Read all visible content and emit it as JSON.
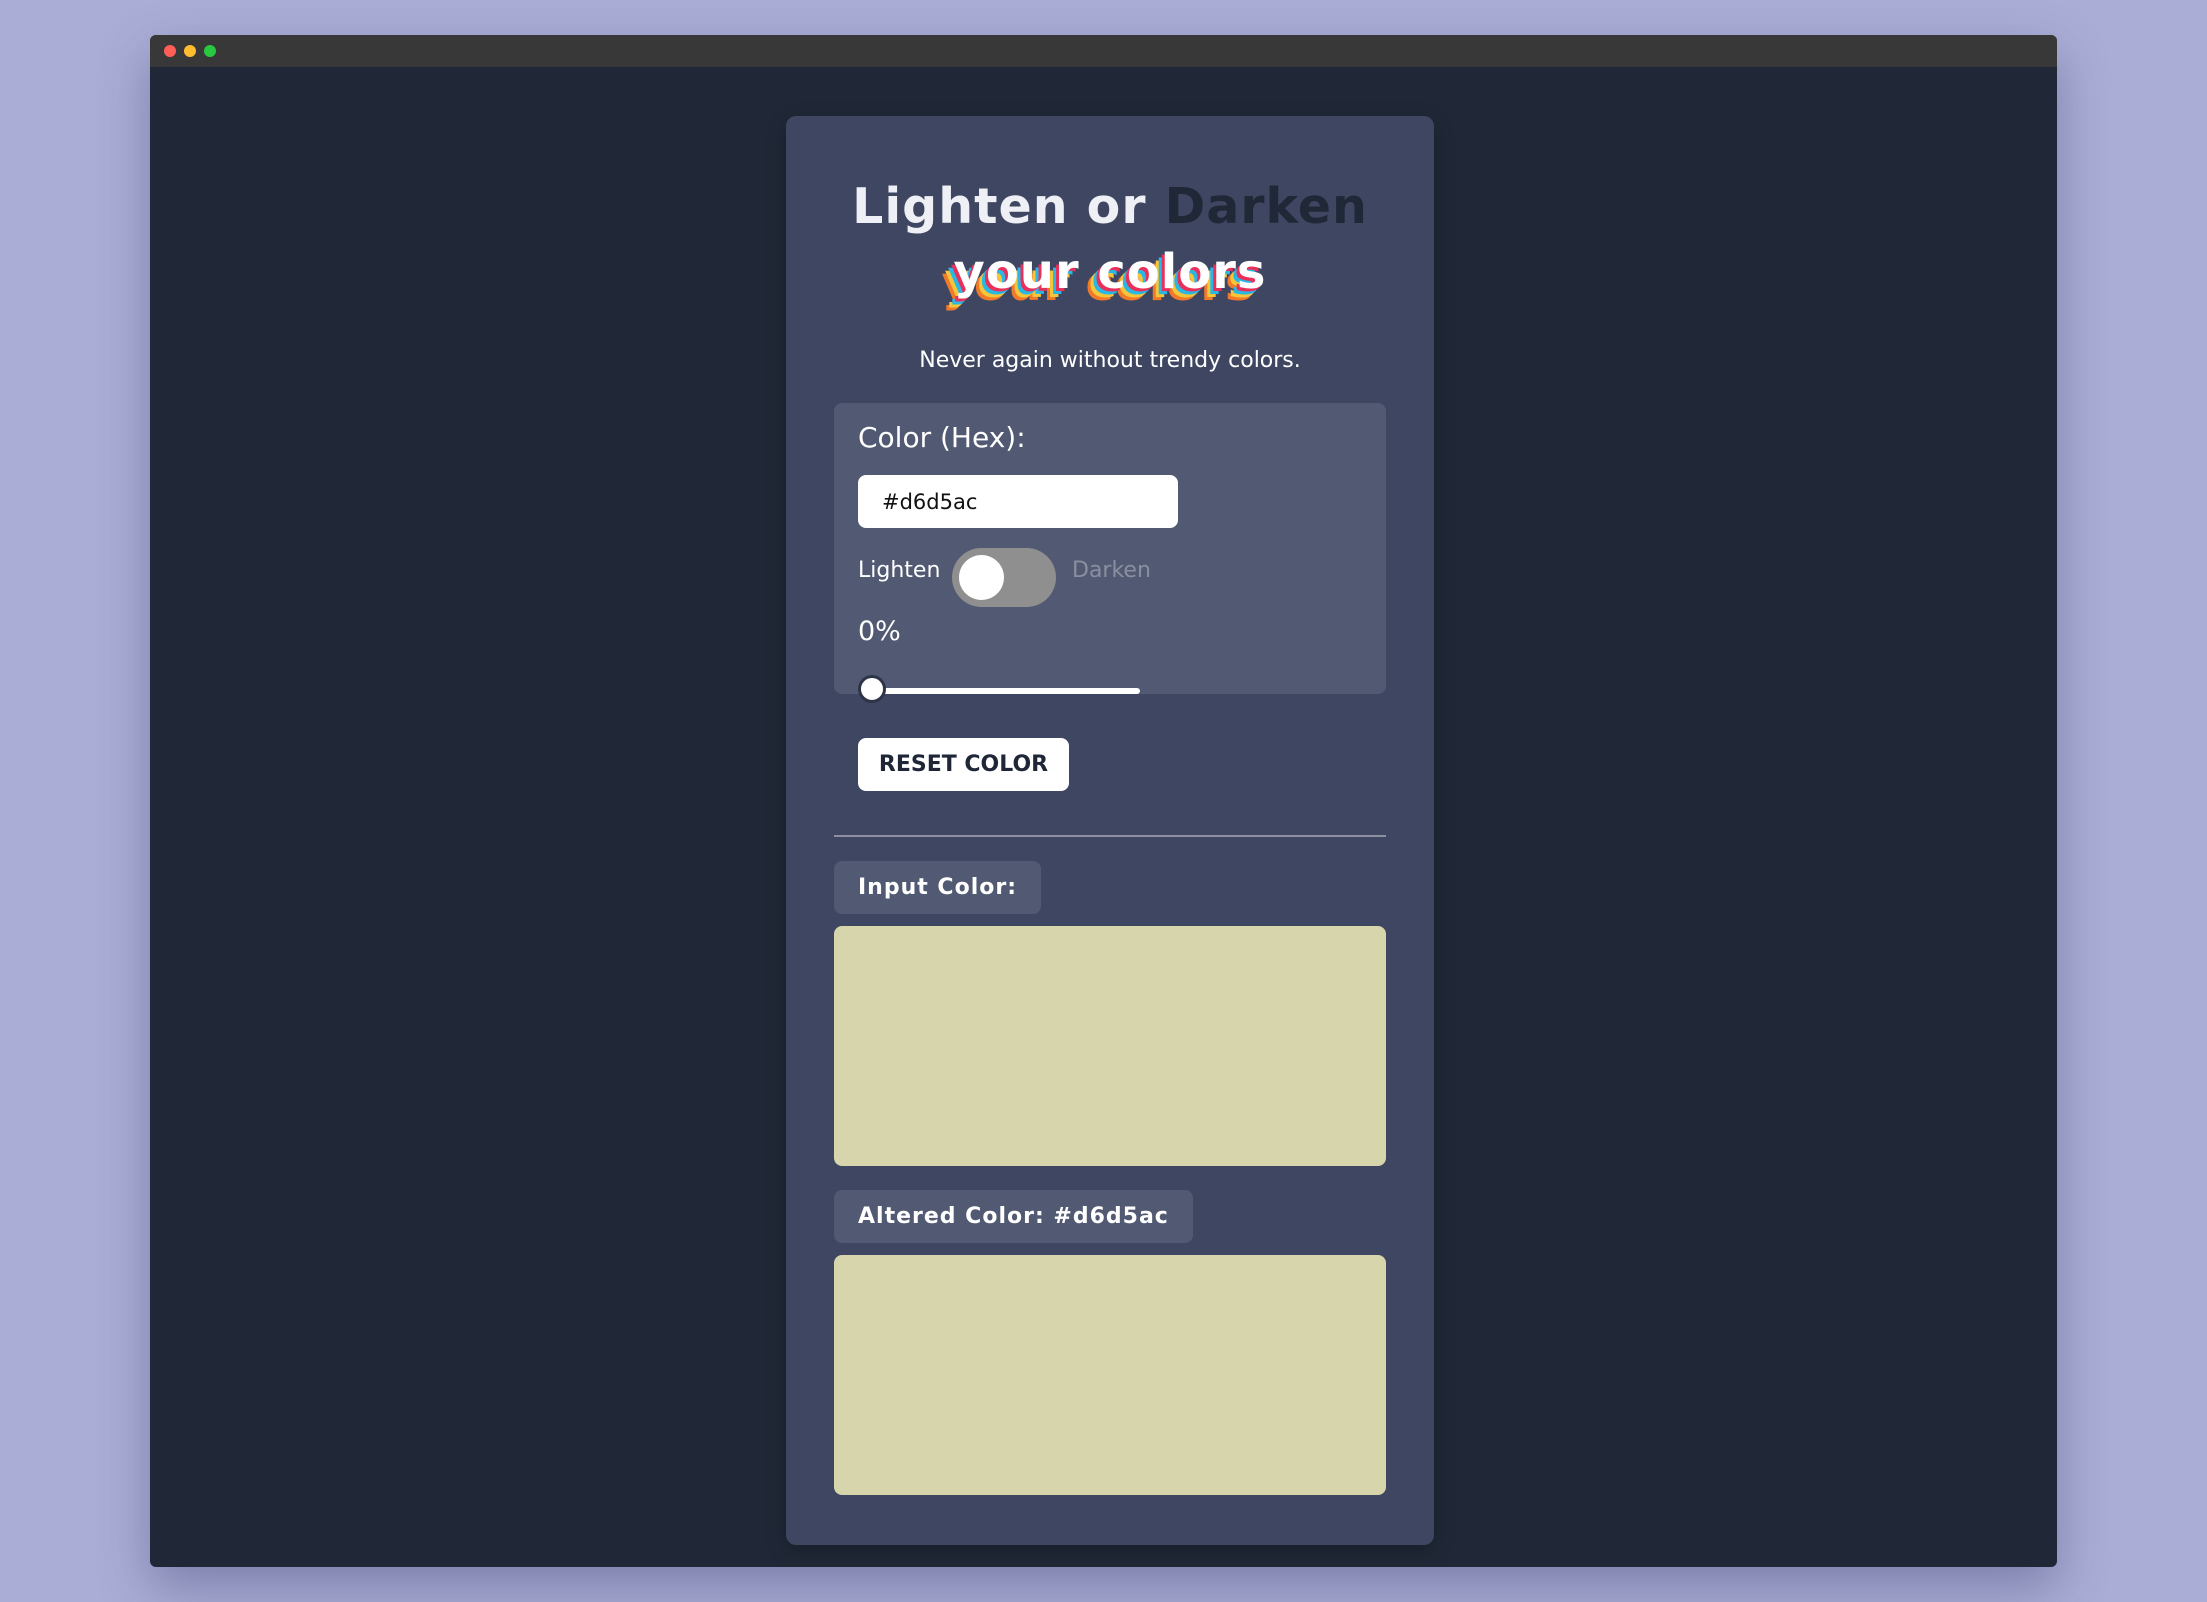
{
  "window": {
    "controls": [
      "close",
      "minimize",
      "maximize"
    ],
    "colors": {
      "close": "#ff5f57",
      "minimize": "#febc2e",
      "maximize": "#28c840"
    }
  },
  "header": {
    "title_light": "Lighten or",
    "title_dark": "Darken",
    "title_line2": "your colors",
    "subtitle": "Never again without trendy colors."
  },
  "controls": {
    "hex_label": "Color (Hex):",
    "hex_value": "#d6d5ac",
    "toggle_left_label": "Lighten",
    "toggle_right_label": "Darken",
    "toggle_state": "lighten",
    "percent_label": "0%",
    "percent_value": 0,
    "reset_label": "RESET COLOR"
  },
  "results": {
    "input_label": "Input Color:",
    "input_color": "#d6d5ac",
    "altered_label": "Altered Color: #d6d5ac",
    "altered_color": "#d6d5ac"
  },
  "theme": {
    "page_background": "#aaaed6",
    "window_background": "#202837",
    "card_background": "#3e4661",
    "panel_background": "#525a73",
    "accent_dark": "#202837"
  }
}
